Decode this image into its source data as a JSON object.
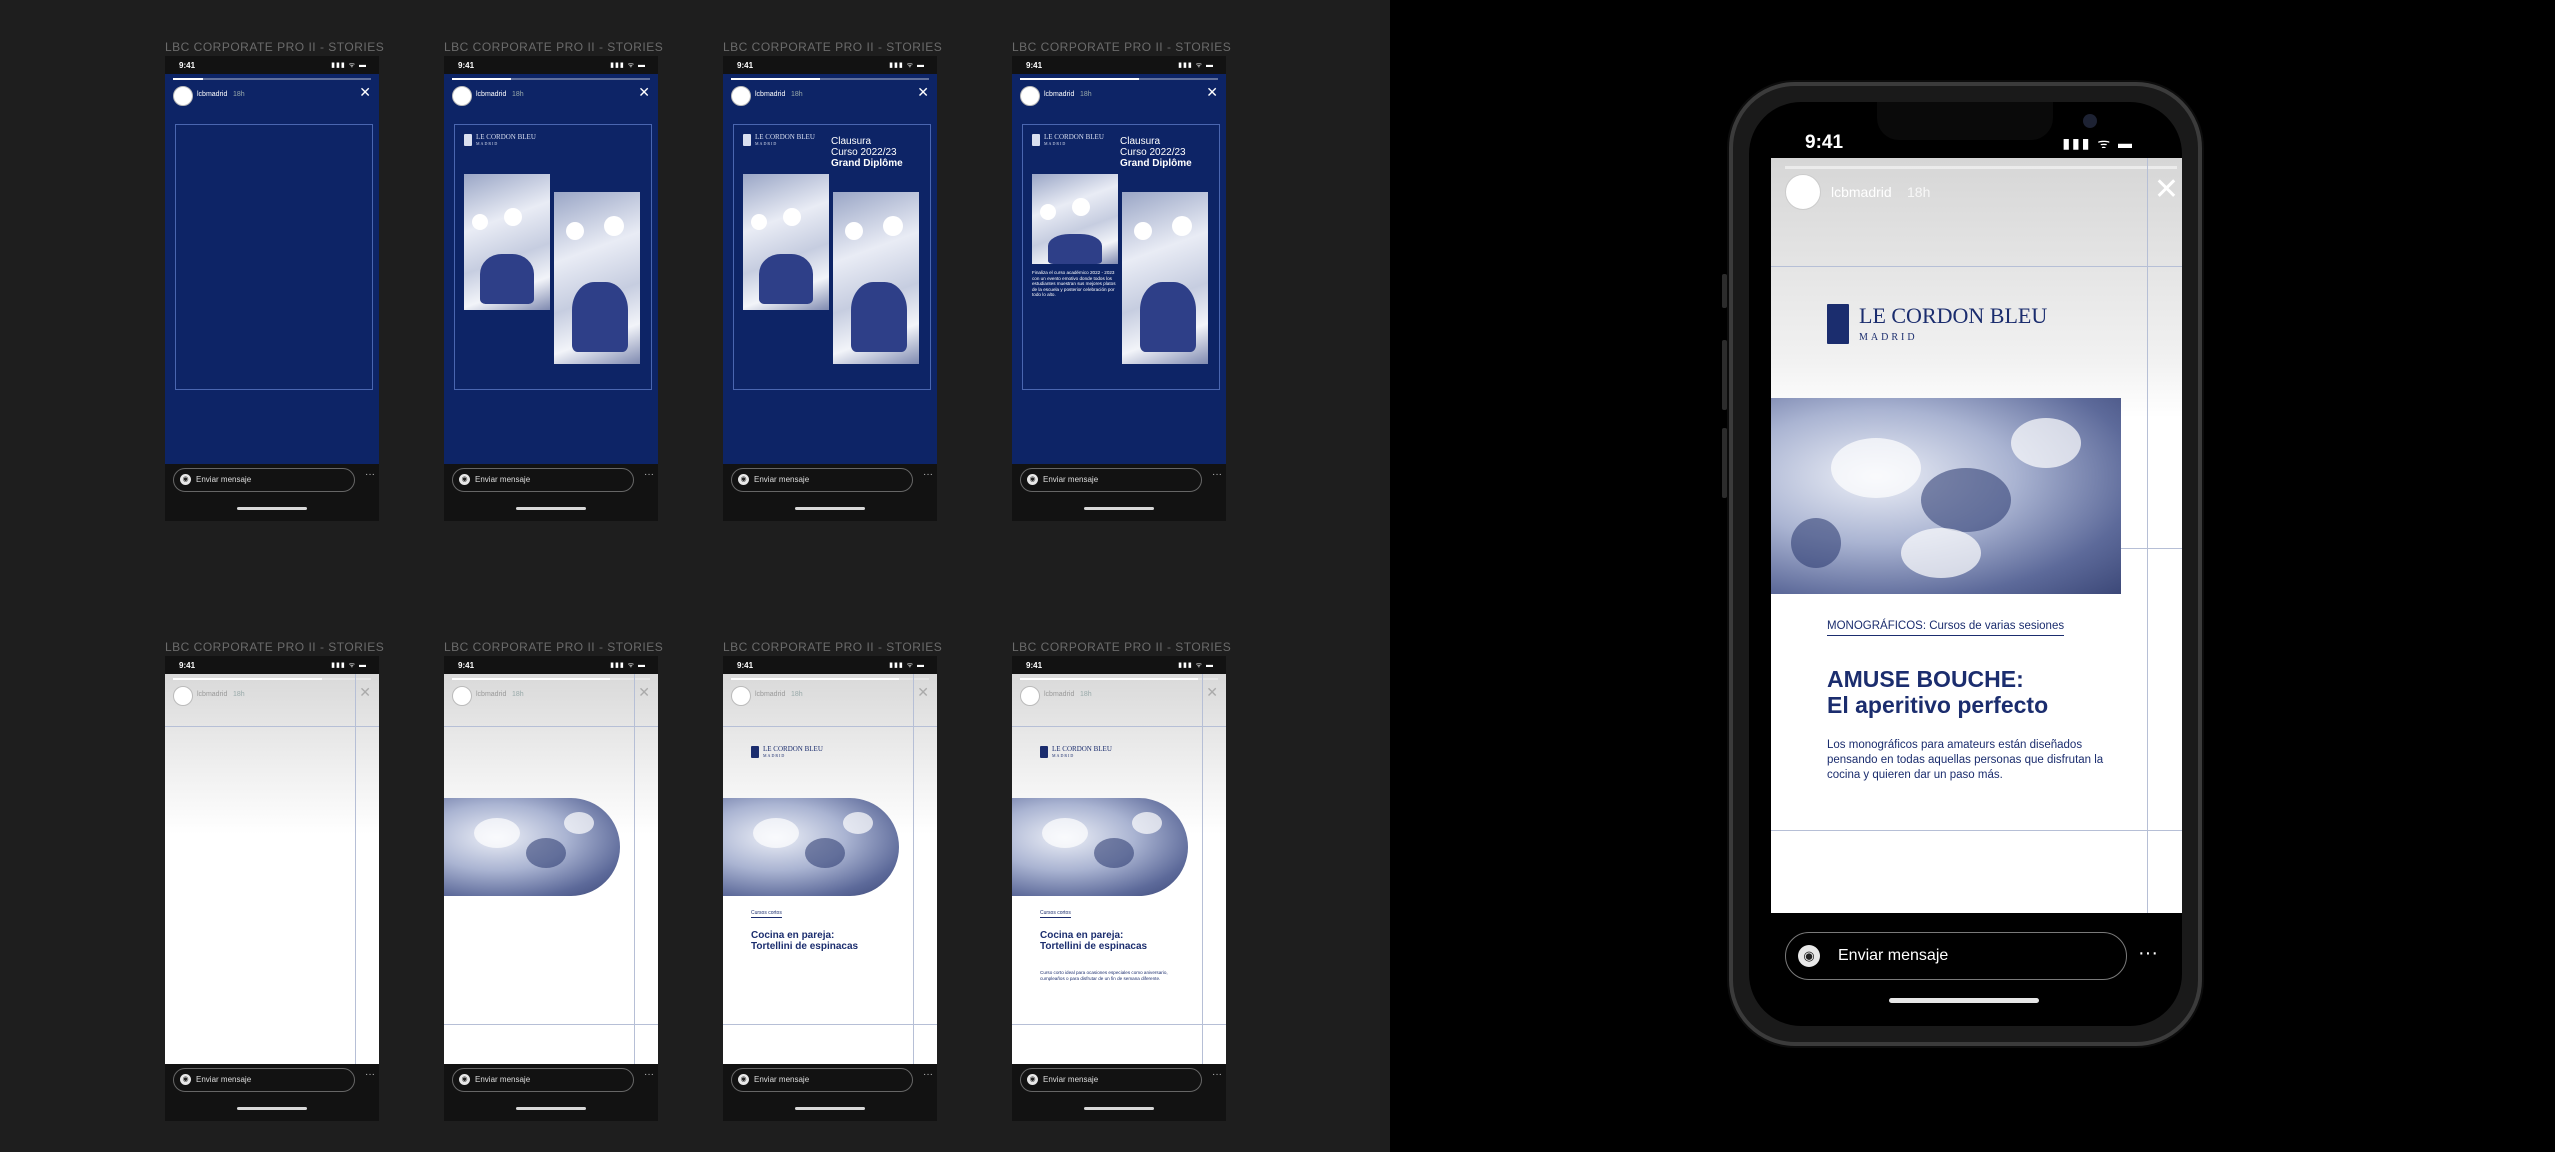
{
  "frame_label": "LBC CORPORATE PRO II - STORIES",
  "status_time": "9:41",
  "status_icons": "▮▮▮ ᯤ ▬",
  "account": "lcbmadrid",
  "time_ago": "18h",
  "close_glyph": "✕",
  "message_placeholder": "Enviar mensaje",
  "camera_glyph": "◉",
  "more_glyph": "···",
  "brand": {
    "name": "LE CORDON BLEU",
    "city": "MADRID",
    "color": "#1b2d6e",
    "story_blue": "#0d2466"
  },
  "clausura": {
    "line1": "Clausura",
    "line2": "Curso 2022/23",
    "line3": "Grand Diplôme",
    "caption": "Finaliza el curso académico 2022 - 2023 con un evento emotivo donde todos los estudiantes muestran sus mejores platos de la escuela y posterior celebración por todo lo alto."
  },
  "pareja": {
    "kicker": "Cursos cortos",
    "line1": "Cocina en pareja:",
    "line2": "Tortellini de espinacas",
    "body": "Curso corto ideal para ocasiones especiales como aniversario, cumpleaños o para disfrutar de un fin de semana diferente."
  },
  "featured": {
    "kicker": "MONOGRÁFICOS: Cursos de varias sesiones",
    "headline1": "AMUSE BOUCHE:",
    "headline2": "El aperitivo perfecto",
    "body": "Los monográficos para amateurs están diseñados pensando en todas aquellas personas que disfrutan la cocina y quieren dar un paso más."
  }
}
